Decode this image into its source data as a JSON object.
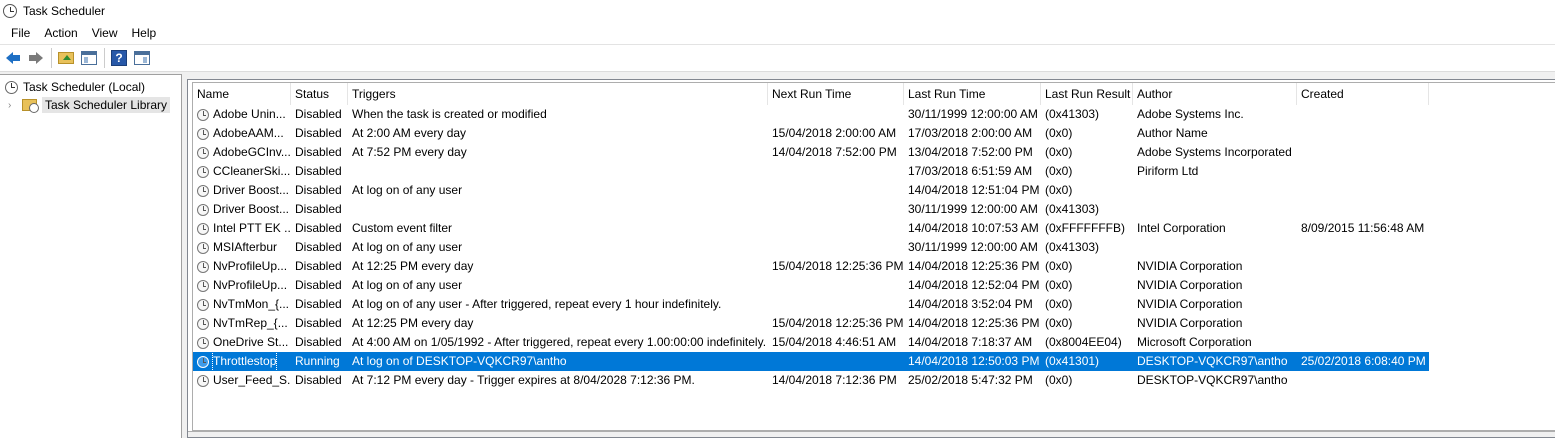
{
  "window": {
    "title": "Task Scheduler"
  },
  "menu": [
    "File",
    "Action",
    "View",
    "Help"
  ],
  "toolbar": {
    "buttons": [
      "back-arrow-icon",
      "forward-arrow-icon",
      "folder-up-icon",
      "show-hide-console-tree-icon",
      "help-icon",
      "show-hide-action-pane-icon"
    ],
    "help_glyph": "?"
  },
  "tree": {
    "root": "Task Scheduler (Local)",
    "child": "Task Scheduler Library",
    "expander": "›"
  },
  "table": {
    "columns": [
      "Name",
      "Status",
      "Triggers",
      "Next Run Time",
      "Last Run Time",
      "Last Run Result",
      "Author",
      "Created"
    ],
    "rows": [
      [
        "Adobe Unin...",
        "Disabled",
        "When the task is created or modified",
        "",
        "30/11/1999 12:00:00 AM",
        "(0x41303)",
        "Adobe Systems Inc.",
        ""
      ],
      [
        "AdobeAAM...",
        "Disabled",
        "At 2:00 AM every day",
        "15/04/2018 2:00:00 AM",
        "17/03/2018 2:00:00 AM",
        "(0x0)",
        "Author Name",
        ""
      ],
      [
        "AdobeGCInv...",
        "Disabled",
        "At 7:52 PM every day",
        "14/04/2018 7:52:00 PM",
        "13/04/2018 7:52:00 PM",
        "(0x0)",
        "Adobe Systems Incorporated",
        ""
      ],
      [
        "CCleanerSki...",
        "Disabled",
        "",
        "",
        "17/03/2018 6:51:59 AM",
        "(0x0)",
        "Piriform Ltd",
        ""
      ],
      [
        "Driver Boost...",
        "Disabled",
        "At log on of any user",
        "",
        "14/04/2018 12:51:04 PM",
        "(0x0)",
        "",
        ""
      ],
      [
        "Driver Boost...",
        "Disabled",
        "",
        "",
        "30/11/1999 12:00:00 AM",
        "(0x41303)",
        "",
        ""
      ],
      [
        "Intel PTT EK ...",
        "Disabled",
        "Custom event filter",
        "",
        "14/04/2018 10:07:53 AM",
        "(0xFFFFFFFB)",
        "Intel Corporation",
        "8/09/2015 11:56:48 AM"
      ],
      [
        "MSIAfterbur",
        "Disabled",
        "At log on of any user",
        "",
        "30/11/1999 12:00:00 AM",
        "(0x41303)",
        "",
        ""
      ],
      [
        "NvProfileUp...",
        "Disabled",
        "At 12:25 PM every day",
        "15/04/2018 12:25:36 PM",
        "14/04/2018 12:25:36 PM",
        "(0x0)",
        "NVIDIA Corporation",
        ""
      ],
      [
        "NvProfileUp...",
        "Disabled",
        "At log on of any user",
        "",
        "14/04/2018 12:52:04 PM",
        "(0x0)",
        "NVIDIA Corporation",
        ""
      ],
      [
        "NvTmMon_{...",
        "Disabled",
        "At log on of any user - After triggered, repeat every 1 hour indefinitely.",
        "",
        "14/04/2018 3:52:04 PM",
        "(0x0)",
        "NVIDIA Corporation",
        ""
      ],
      [
        "NvTmRep_{...",
        "Disabled",
        "At 12:25 PM every day",
        "15/04/2018 12:25:36 PM",
        "14/04/2018 12:25:36 PM",
        "(0x0)",
        "NVIDIA Corporation",
        ""
      ],
      [
        "OneDrive St...",
        "Disabled",
        "At 4:00 AM on 1/05/1992 - After triggered, repeat every 1.00:00:00 indefinitely.",
        "15/04/2018 4:46:51 AM",
        "14/04/2018 7:18:37 AM",
        "(0x8004EE04)",
        "Microsoft Corporation",
        ""
      ],
      [
        "Throttlestop",
        "Running",
        "At log on of DESKTOP-VQKCR97\\antho",
        "",
        "14/04/2018 12:50:03 PM",
        "(0x41301)",
        "DESKTOP-VQKCR97\\antho",
        "25/02/2018 6:08:40 PM"
      ],
      [
        "User_Feed_S...",
        "Disabled",
        "At 7:12 PM every day - Trigger expires at 8/04/2028 7:12:36 PM.",
        "14/04/2018 7:12:36 PM",
        "25/02/2018 5:47:32 PM",
        "(0x0)",
        "DESKTOP-VQKCR97\\antho",
        ""
      ]
    ],
    "selected_row_index": 13,
    "selection_color": "#0078d7"
  }
}
